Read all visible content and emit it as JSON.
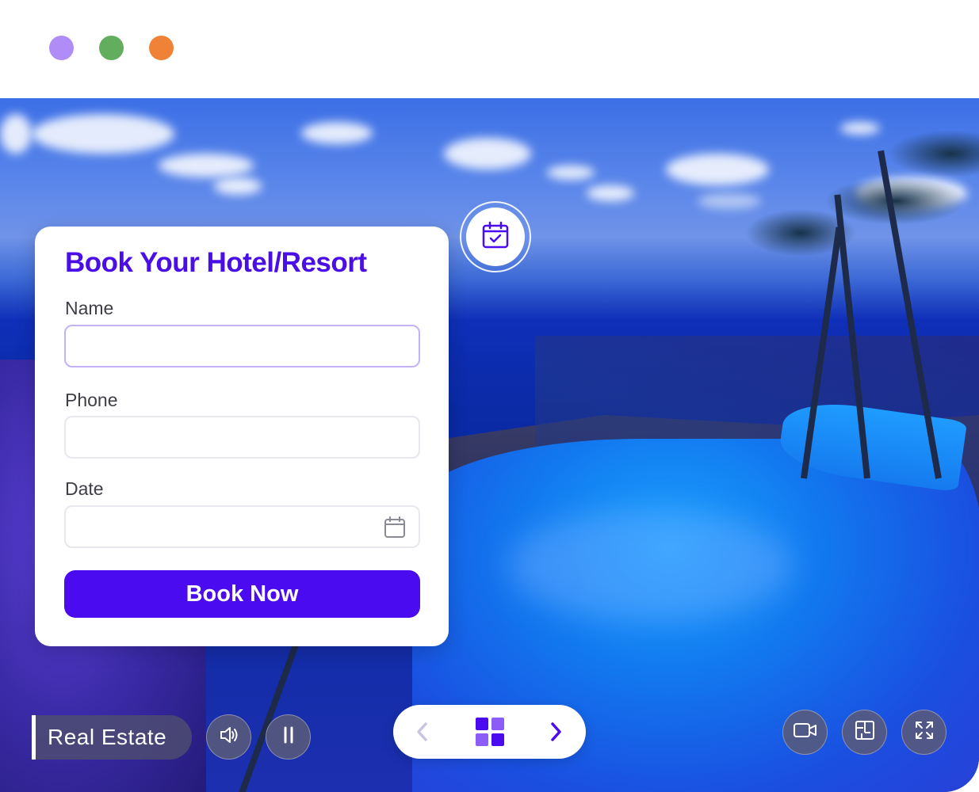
{
  "window": {
    "dots": [
      "#b08cf6",
      "#63ad5e",
      "#ef8236"
    ]
  },
  "booking_form": {
    "title": "Book Your Hotel/Resort",
    "name_label": "Name",
    "name_value": "",
    "phone_label": "Phone",
    "phone_value": "",
    "date_label": "Date",
    "date_value": "",
    "submit_label": "Book Now",
    "accent_color": "#4a0bf0"
  },
  "tour_controls": {
    "category_label": "Real Estate",
    "audio_icon": "speaker-icon",
    "pause_icon": "pause-icon",
    "prev_icon": "chevron-left-icon",
    "grid_icon": "grid-icon",
    "next_icon": "chevron-right-icon",
    "video_icon": "video-camera-icon",
    "floorplan_icon": "floor-plan-icon",
    "fullscreen_icon": "fullscreen-icon",
    "calendar_icon": "calendar-check-icon"
  }
}
